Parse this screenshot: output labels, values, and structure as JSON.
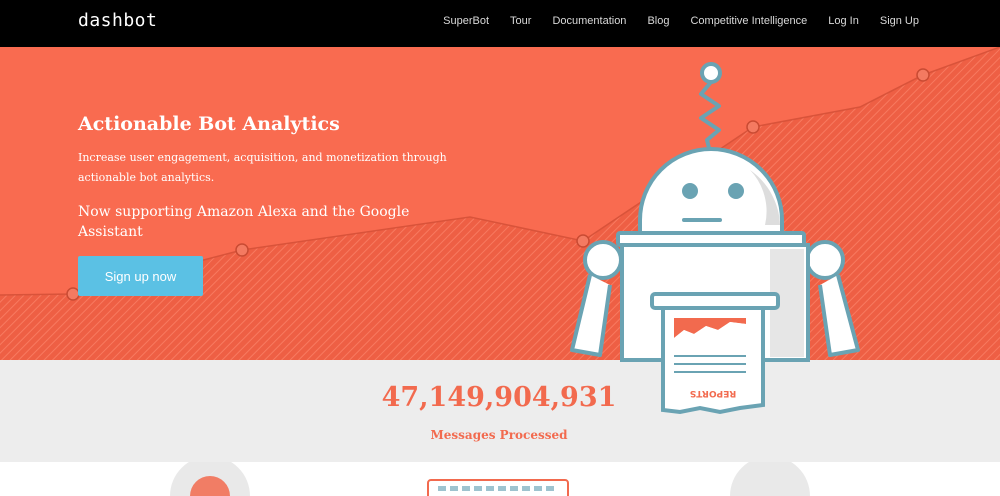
{
  "brand": {
    "name": "dashbot"
  },
  "nav": {
    "items": [
      {
        "label": "SuperBot"
      },
      {
        "label": "Tour"
      },
      {
        "label": "Documentation"
      },
      {
        "label": "Blog"
      },
      {
        "label": "Competitive Intelligence"
      },
      {
        "label": "Log In"
      },
      {
        "label": "Sign Up"
      }
    ]
  },
  "hero": {
    "title": "Actionable Bot Analytics",
    "description": "Increase user engagement, acquisition, and monetization through actionable bot analytics.",
    "subtitle": "Now supporting Amazon Alexa and the Google Assistant",
    "cta_label": "Sign up now"
  },
  "robot": {
    "paper_label": "REPORTS"
  },
  "stats": {
    "number": "47,149,904,931",
    "label": "Messages Processed"
  },
  "colors": {
    "hero_bg": "#f96b50",
    "hero_dark": "#e95a40",
    "nav_bg": "#000000",
    "cta": "#5bc1e4",
    "stat_text": "#f26a4e",
    "robot_outline": "#6aa3b3"
  }
}
